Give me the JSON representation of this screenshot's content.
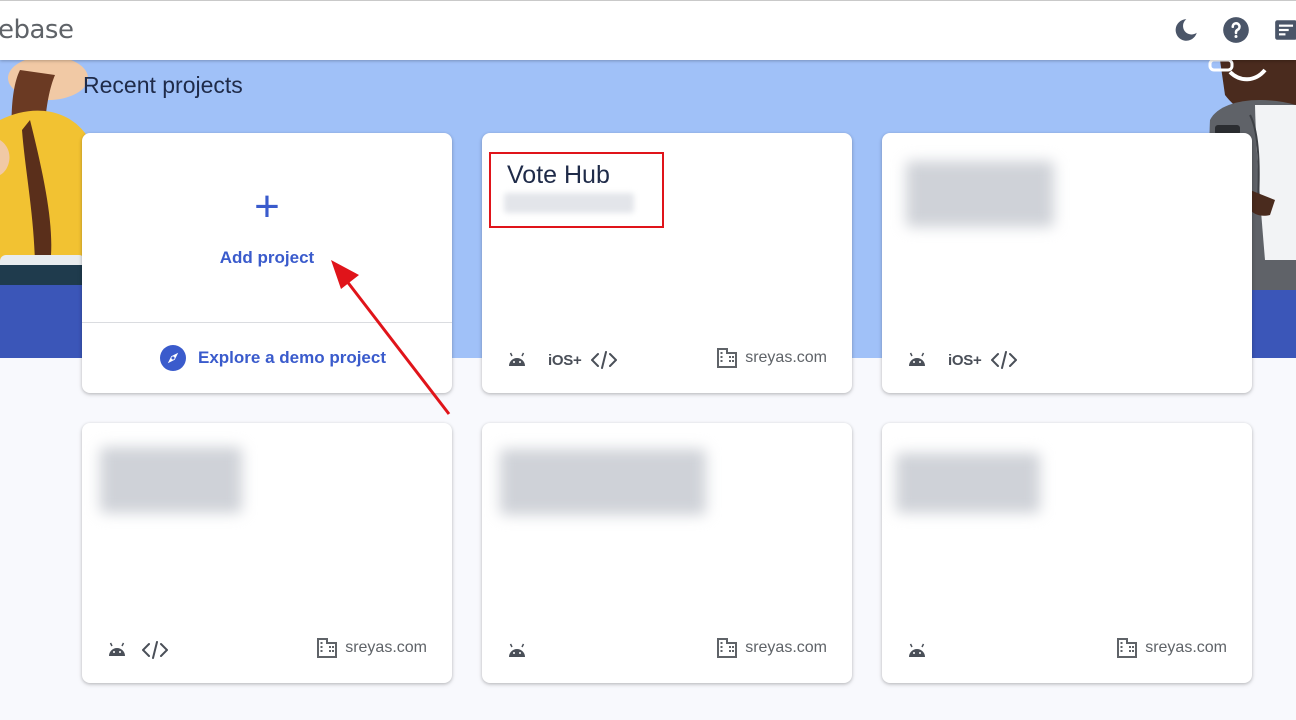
{
  "header": {
    "brand_text": "ebase",
    "icons": [
      "dark-mode-icon",
      "help-icon",
      "notes-icon"
    ]
  },
  "main": {
    "heading": "Recent projects",
    "add_card": {
      "plus_glyph": "+",
      "label": "Add project",
      "explore_label": "Explore a demo project"
    },
    "projects": [
      {
        "title": "Vote Hub",
        "platforms": [
          "android",
          "ios",
          "web"
        ],
        "org": "sreyas.com"
      },
      {
        "title": "",
        "platforms": [
          "android",
          "ios",
          "web"
        ],
        "org": ""
      },
      {
        "title": "",
        "platforms": [
          "android",
          "web"
        ],
        "org": "sreyas.com"
      },
      {
        "title": "",
        "platforms": [
          "android"
        ],
        "org": "sreyas.com"
      },
      {
        "title": "",
        "platforms": [
          "android"
        ],
        "org": "sreyas.com"
      }
    ],
    "ios_label": "iOS+"
  },
  "colors": {
    "accent": "#3a5bcc",
    "hero_bg": "#a0c1f8",
    "annotation": "#e0141a"
  }
}
